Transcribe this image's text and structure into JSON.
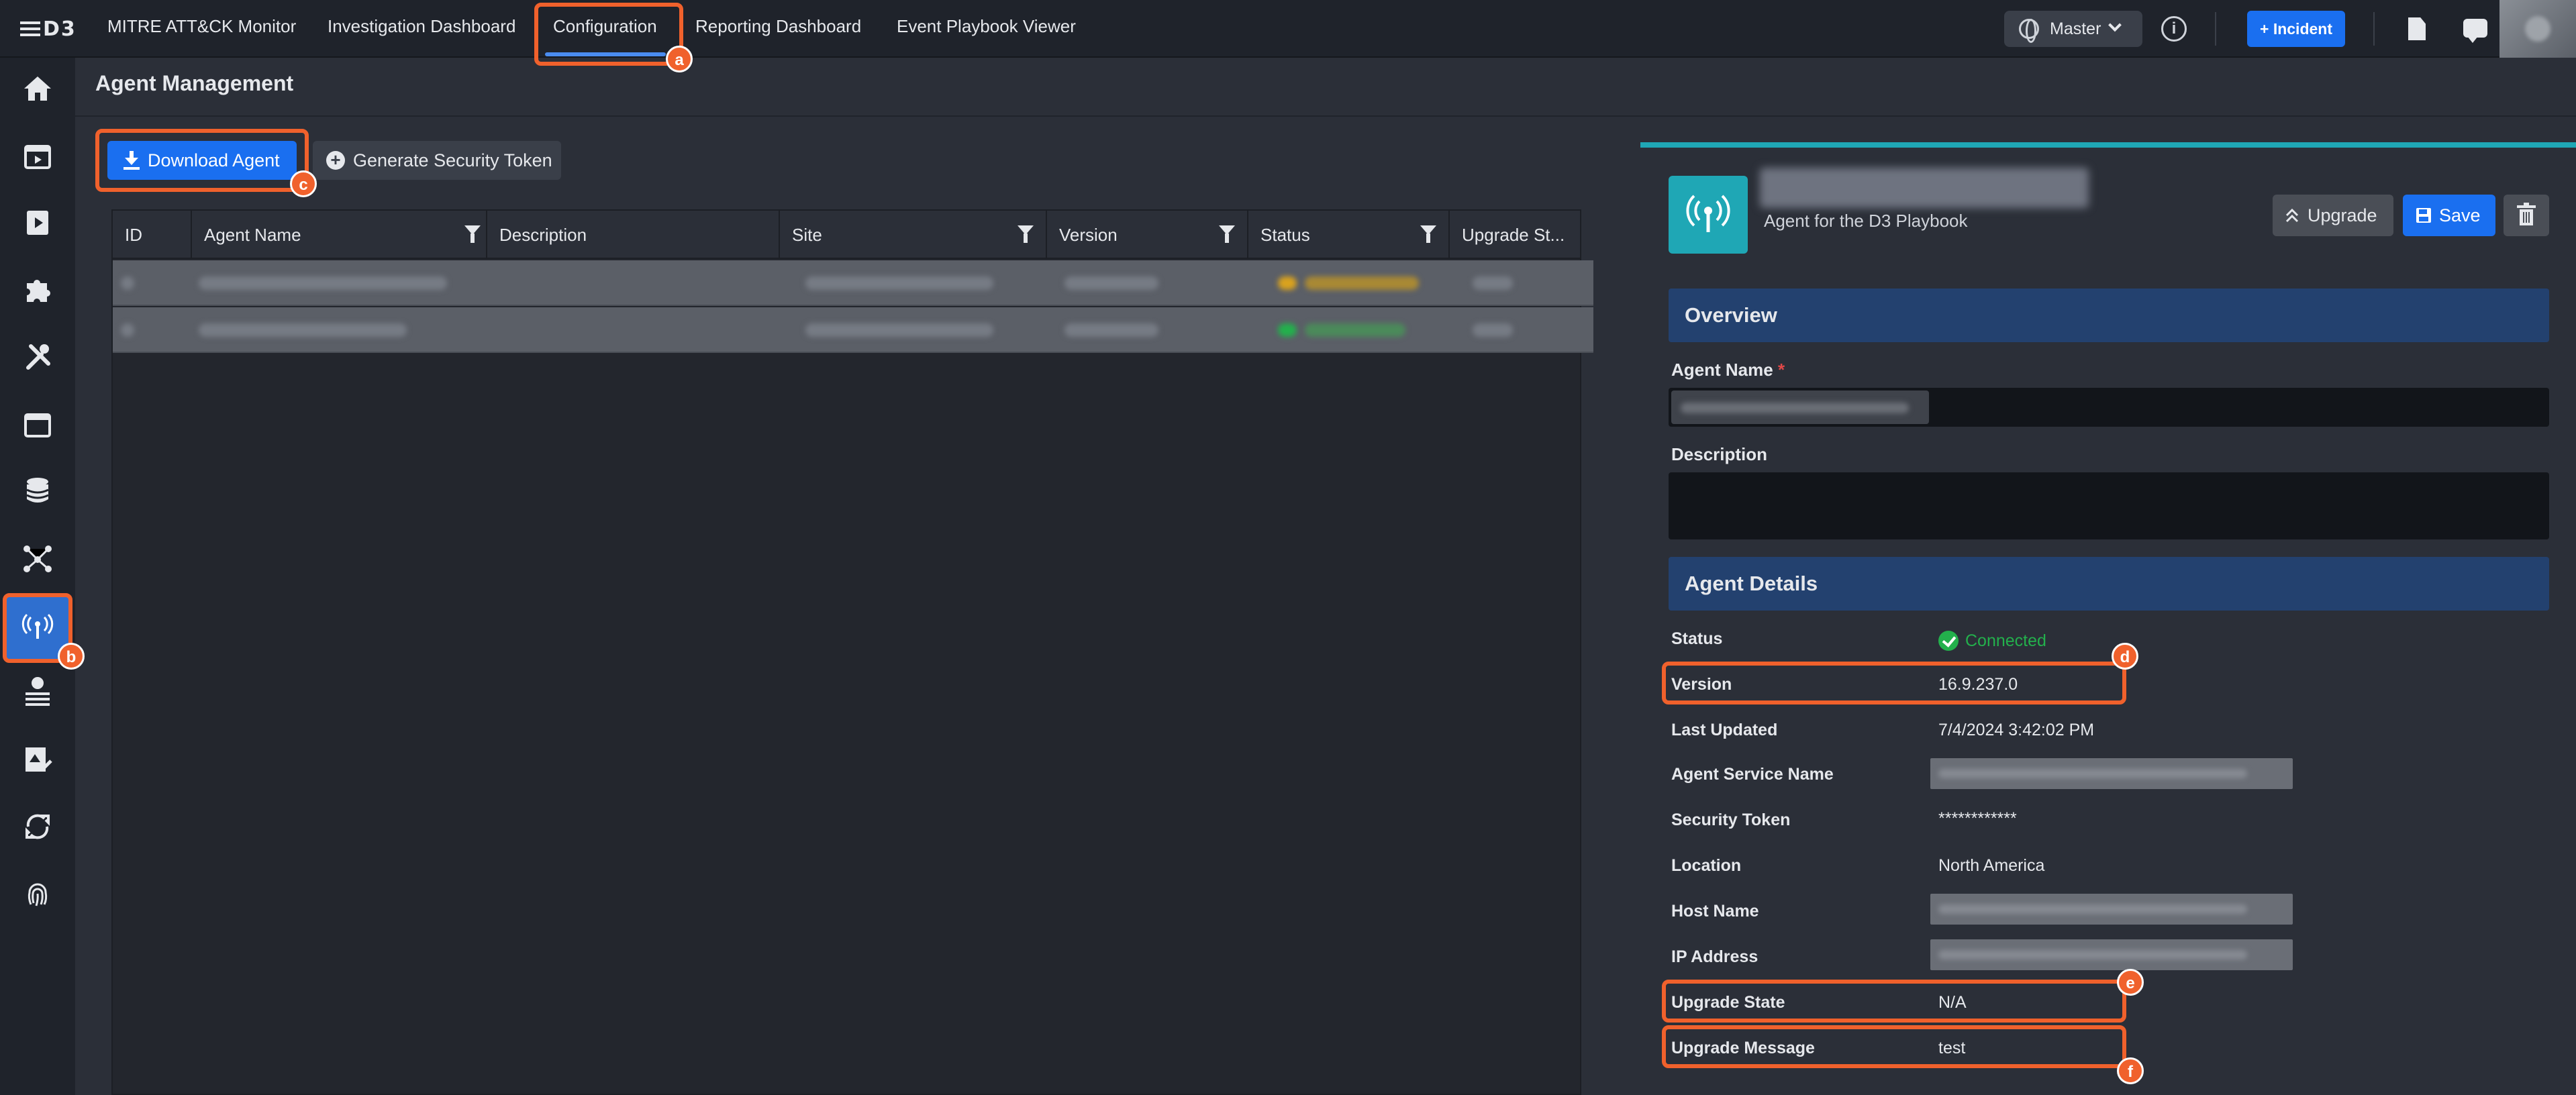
{
  "topnav": {
    "logo": "D3",
    "tabs": [
      {
        "label": "MITRE ATT&CK Monitor"
      },
      {
        "label": "Investigation Dashboard"
      },
      {
        "label": "Configuration"
      },
      {
        "label": "Reporting Dashboard"
      },
      {
        "label": "Event Playbook Viewer"
      }
    ],
    "active_tab": "Configuration",
    "site_selector": "Master",
    "incident_button": "+ Incident"
  },
  "sidebar": {
    "items": [
      {
        "icon": "home-icon"
      },
      {
        "icon": "event-calendar-icon"
      },
      {
        "icon": "playbook-icon"
      },
      {
        "icon": "integration-puzzle-icon"
      },
      {
        "icon": "tools-wrench-icon"
      },
      {
        "icon": "calendar-icon"
      },
      {
        "icon": "database-icon"
      },
      {
        "icon": "network-graph-icon"
      },
      {
        "icon": "agent-antenna-icon"
      },
      {
        "icon": "threat-intel-globe-icon"
      },
      {
        "icon": "report-edit-icon"
      },
      {
        "icon": "sync-icon"
      },
      {
        "icon": "fingerprint-icon"
      }
    ],
    "active_item": "agent-antenna-icon"
  },
  "page": {
    "title": "Agent Management"
  },
  "toolbar": {
    "download_label": "Download Agent",
    "token_label": "Generate Security Token"
  },
  "table": {
    "columns": [
      "ID",
      "Agent Name",
      "Description",
      "Site",
      "Version",
      "Status",
      "Upgrade St..."
    ]
  },
  "detail": {
    "subtitle": "Agent for the D3 Playbook",
    "upgrade_label": "Upgrade",
    "save_label": "Save",
    "overview_title": "Overview",
    "agent_name_label": "Agent Name",
    "required_mark": "*",
    "description_label": "Description",
    "details_title": "Agent Details",
    "rows": {
      "status_label": "Status",
      "status_value": "Connected",
      "version_label": "Version",
      "version_value": "16.9.237.0",
      "last_updated_label": "Last Updated",
      "last_updated_value": "7/4/2024 3:42:02 PM",
      "service_name_label": "Agent Service Name",
      "security_token_label": "Security Token",
      "security_token_value": "************",
      "location_label": "Location",
      "location_value": "North America",
      "host_name_label": "Host Name",
      "ip_address_label": "IP Address",
      "upgrade_state_label": "Upgrade State",
      "upgrade_state_value": "N/A",
      "upgrade_message_label": "Upgrade Message",
      "upgrade_message_value": "test"
    }
  },
  "annotations": [
    "a",
    "b",
    "c",
    "d",
    "e",
    "f"
  ],
  "colors": {
    "accent": "#1a6ff0",
    "highlight": "#f0612c",
    "teal": "#1fa7b5",
    "section": "#23416f",
    "connected": "#23b04c"
  }
}
